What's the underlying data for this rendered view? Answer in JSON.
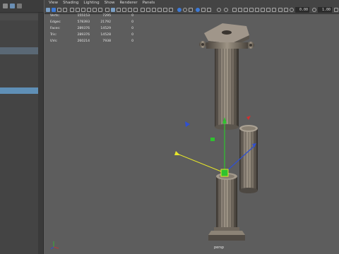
{
  "menu": [
    "View",
    "Shading",
    "Lighting",
    "Show",
    "Renderer",
    "Panels"
  ],
  "toolbar": {
    "field_a": "0.00",
    "field_b": "1.00"
  },
  "hud": {
    "rows": [
      {
        "label": "Verts:",
        "v1": "155153",
        "v2": "7295",
        "v3": "0"
      },
      {
        "label": "Edges:",
        "v1": "578393",
        "v2": "21792",
        "v3": "0"
      },
      {
        "label": "Faces:",
        "v1": "289376",
        "v2": "14529",
        "v3": "0"
      },
      {
        "label": "Tris:",
        "v1": "289376",
        "v2": "14528",
        "v3": "0"
      },
      {
        "label": "UVs:",
        "v1": "260214",
        "v2": "7938",
        "v3": "0"
      }
    ]
  },
  "viewport": {
    "camera": "persp"
  },
  "colors": {
    "selection_highlight": "#5f8fb6",
    "axis_x": "#d23030",
    "axis_y": "#2fc22f",
    "axis_z": "#2f4fd2",
    "manipulator_yellow": "#e6e62a"
  }
}
